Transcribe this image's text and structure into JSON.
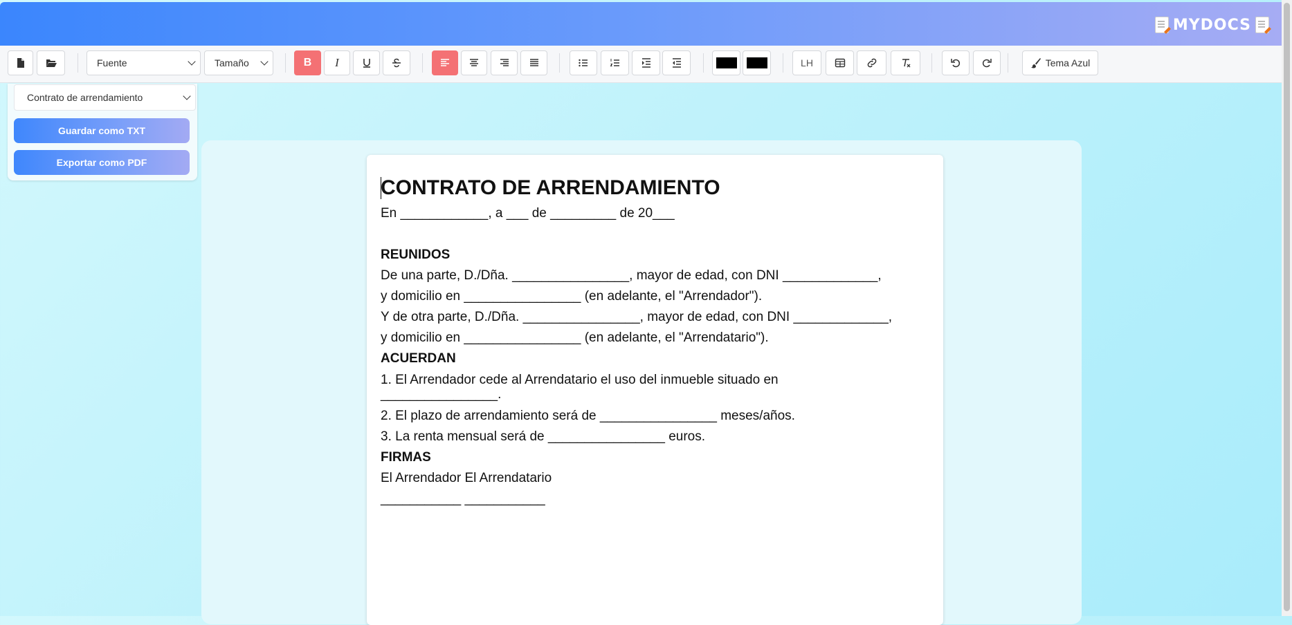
{
  "brand": {
    "name": "MYDOCS"
  },
  "toolbar": {
    "font_label": "Fuente",
    "size_label": "Tamaño",
    "bold_label": "B",
    "italic_label": "I",
    "lh_label": "LH",
    "theme_label": "Tema Azul",
    "text_color": "#000000",
    "bg_color": "#000000",
    "active_color": "#f47174"
  },
  "sidebar": {
    "template_selected": "Contrato de arrendamiento",
    "save_txt_label": "Guardar como TXT",
    "export_pdf_label": "Exportar como PDF"
  },
  "document": {
    "title": "CONTRATO DE ARRENDAMIENTO",
    "date_line": "En ____________, a ___ de _________ de 20___",
    "reunidos": "REUNIDOS",
    "party1_line1": "De una parte, D./Dña. ________________, mayor de edad, con DNI _____________,",
    "party1_line2": "y domicilio en ________________ (en adelante, el \"Arrendador\").",
    "party2_line1": "Y de otra parte, D./Dña. ________________, mayor de edad, con DNI _____________,",
    "party2_line2": "y domicilio en ________________ (en adelante, el \"Arrendatario\").",
    "acuerdan": "ACUERDAN",
    "clause1_line1": "1. El Arrendador cede al Arrendatario el uso del inmueble situado en",
    "clause1_line2": "________________.",
    "clause2": "2. El plazo de arrendamiento será de ________________ meses/años.",
    "clause3": "3. La renta mensual será de ________________ euros.",
    "firmas": "FIRMAS",
    "signatures_labels": "El Arrendador El Arrendatario",
    "signature_lines": "___________ ___________"
  }
}
